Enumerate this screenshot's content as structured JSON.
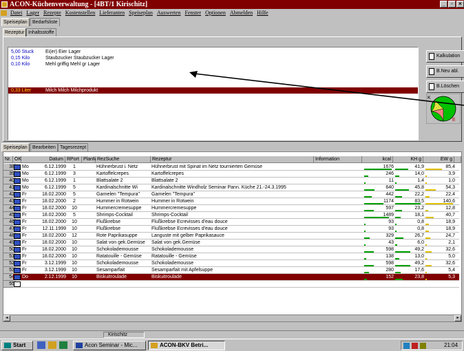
{
  "window": {
    "title": "ACON-Küchenverwaltung - [4BT/1 Kirischitz]",
    "capbtns": [
      "_",
      "▫",
      "×"
    ]
  },
  "menu": [
    "Datei",
    "Lager",
    "Rezepte",
    "Kostenstellen",
    "Lieferanten",
    "Speiseplan",
    "Auswerten",
    "Fenster",
    "Optionen",
    "Abmelden",
    "Hilfe"
  ],
  "tabs_top": [
    "Speiseplan",
    "Bedarfsliste"
  ],
  "tabs_sub": [
    "Rezeptur",
    "Inhaltsstoffe"
  ],
  "ingredients": [
    {
      "qty": "5,00 Stuck",
      "name": "Ei(er) Eier Lager"
    },
    {
      "qty": "0,15 Kilo",
      "name": "Staubzucker Staubzucker Lager"
    },
    {
      "qty": "0,10 Kilo",
      "name": "Mehl griffig Mehl gr Lager"
    },
    {
      "qty": "0,33 Liter",
      "name": "Milch Milch Milchprodukt"
    }
  ],
  "side_buttons": [
    "Kalkulation",
    "B.Neu abl.",
    "B.Löschen"
  ],
  "pie_labels": {
    "k": "K",
    "e": "E"
  },
  "tabs_bottom": [
    "Speiseplan",
    "Bearbeiten",
    "Tagesrezept"
  ],
  "columns": [
    "Nr.",
    "OK",
    "Datum",
    "RPort",
    "PlanM",
    "RezSuche",
    "Rezeptur",
    "Information",
    "kcal",
    "KH g",
    "EW g"
  ],
  "rows": [
    {
      "nr": "38",
      "day": "Mo",
      "date": "6.12.1999",
      "port": "1",
      "suche": "Hühnerbrust i. Netz",
      "rez": "Hühnerbrust mit Spinat im Netz tournierten Gemüse",
      "kcal": "1676",
      "kh": "41,9",
      "ew": "85,4"
    },
    {
      "nr": "39",
      "day": "Mo",
      "date": "6.12.1999",
      "port": "3",
      "suche": "Kartoffelcrepes",
      "rez": "Kartoffelcrepes",
      "kcal": "246",
      "kh": "14,0",
      "ew": "3,9"
    },
    {
      "nr": "40",
      "day": "Mo",
      "date": "6.12.1999",
      "port": "1",
      "suche": "Blattsalate 2",
      "rez": "Blattsalate 2",
      "kcal": "11",
      "kh": "1,4",
      "ew": "1,0"
    },
    {
      "nr": "41",
      "day": "Mo",
      "date": "6.12.1999",
      "port": "5",
      "suche": "Kardinalschnitte Wi",
      "rez": "Kardinalschnitte Windholz Seminar Pann. Küche 21.-24.3.1995",
      "kcal": "640",
      "kh": "45,8",
      "ew": "54,3"
    },
    {
      "nr": "42",
      "day": "Fr",
      "date": "18.02.2000",
      "port": "5",
      "suche": "Garnelen \"Tempura\"",
      "rez": "Garnelen \"Tempura\"",
      "kcal": "442",
      "kh": "22,2",
      "ew": "22,4"
    },
    {
      "nr": "43",
      "day": "Fr",
      "date": "18.02.2000",
      "port": "2",
      "suche": "Hummer in Rotwein",
      "rez": "Hummer in Rotwein",
      "kcal": "1174",
      "kh": "83,5",
      "ew": "140,6"
    },
    {
      "nr": "44",
      "day": "Fr",
      "date": "18.02.2000",
      "port": "10",
      "suche": "Hummercremesuppe",
      "rez": "Hummercremesuppe",
      "kcal": "597",
      "kh": "23,2",
      "ew": "12,8"
    },
    {
      "nr": "45",
      "day": "Fr",
      "date": "18.02.2000",
      "port": "5",
      "suche": "Shrimps-Cocktail",
      "rez": "Shrimps-Cocktail",
      "kcal": "1489",
      "kh": "18,1",
      "ew": "40,7"
    },
    {
      "nr": "46",
      "day": "Fr",
      "date": "18.02.2000",
      "port": "10",
      "suche": "Flußkrebse",
      "rez": "Flußkrebse Ecrevisses d'eau douce",
      "kcal": "93",
      "kh": "0,8",
      "ew": "18,9"
    },
    {
      "nr": "47",
      "day": "Fr",
      "date": "12.11.1999",
      "port": "10",
      "suche": "Flußkrebse",
      "rez": "Flußkrebse Ecrevisses d'eau douce",
      "kcal": "93",
      "kh": "0,8",
      "ew": "18,9"
    },
    {
      "nr": "48",
      "day": "Fr",
      "date": "18.02.2000",
      "port": "12",
      "suche": "Rote Paprikasuppe",
      "rez": "Languste mit gelber Paprikasauce",
      "kcal": "329",
      "kh": "26,7",
      "ew": "24,7"
    },
    {
      "nr": "49",
      "day": "Fr",
      "date": "18.02.2000",
      "port": "10",
      "suche": "Salat von gek.Gemüse",
      "rez": "Salat von gek.Gemüse",
      "kcal": "43",
      "kh": "6,0",
      "ew": "2,1"
    },
    {
      "nr": "50",
      "day": "Fr",
      "date": "18.02.2000",
      "port": "10",
      "suche": "Schokolademousse",
      "rez": "Schokolademousse",
      "kcal": "598",
      "kh": "49,2",
      "ew": "32,6"
    },
    {
      "nr": "51",
      "day": "Fr",
      "date": "18.02.2000",
      "port": "10",
      "suche": "Ratatouille - Gemüse",
      "rez": "Ratatouille - Gemüse",
      "kcal": "138",
      "kh": "13,0",
      "ew": "5,0"
    },
    {
      "nr": "52",
      "day": "Fr",
      "date": "3.12.1999",
      "port": "10",
      "suche": "Schokolademousse",
      "rez": "Schokolademousse",
      "kcal": "598",
      "kh": "49,2",
      "ew": "32,6"
    },
    {
      "nr": "53",
      "day": "Fr",
      "date": "3.12.1999",
      "port": "10",
      "suche": "Sesamparfait",
      "rez": "Sesamparfait mit Apfelsuppe",
      "kcal": "280",
      "kh": "17,6",
      "ew": "5,4"
    },
    {
      "nr": "54",
      "day": "Do",
      "date": "2.12.1999",
      "port": "10",
      "suche": "Biskuitroulade",
      "rez": "Biskuitroulade",
      "kcal": "152",
      "kh": "23,8",
      "ew": "5,3"
    },
    {
      "nr": "55",
      "day": "",
      "date": "",
      "port": "",
      "suche": "",
      "rez": "",
      "kcal": "",
      "kh": "",
      "ew": ""
    }
  ],
  "statusbar": {
    "user": "Kirischitz"
  },
  "taskbar": {
    "start": "Start",
    "items": [
      "Acon Seminar - Mic...",
      "ACON-BKV Betri..."
    ],
    "clock": "21:04"
  }
}
